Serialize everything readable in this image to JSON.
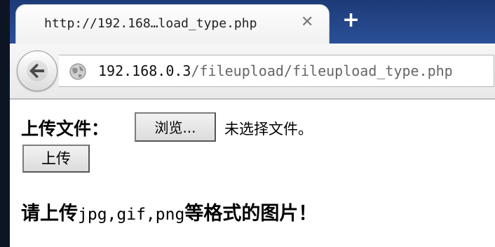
{
  "browser": {
    "tab_title": "http://192.168…load_type.php",
    "tab_close_icon": "close-icon",
    "new_tab_icon": "plus-icon",
    "back_icon": "back-arrow-icon",
    "site_icon": "globe-icon",
    "url_host": "192.168.0.3",
    "url_path": "/fileupload/fileupload_type.php",
    "close_glyph": "✕",
    "new_tab_glyph": "+"
  },
  "page": {
    "upload_label": "上传文件：",
    "browse_button": "浏览...",
    "no_file_text": "未选择文件。",
    "submit_button": "上传",
    "notice_prefix": "请上传",
    "notice_formats": "jpg,gif,png",
    "notice_suffix": "等格式的图片！"
  }
}
